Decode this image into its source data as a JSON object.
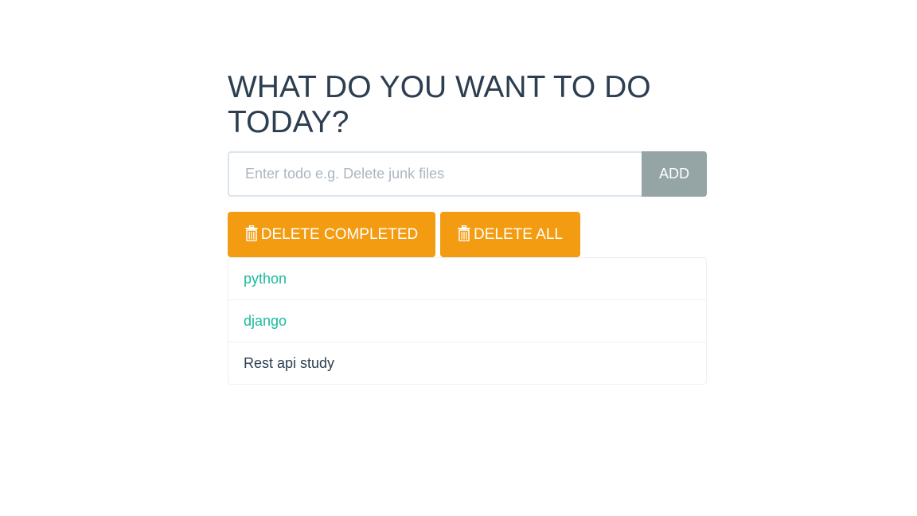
{
  "header": {
    "title": "WHAT DO YOU WANT TO DO TODAY?"
  },
  "form": {
    "input_value": "",
    "input_placeholder": "Enter todo e.g. Delete junk files",
    "add_label": "ADD"
  },
  "actions": {
    "delete_completed_label": "DELETE COMPLETED",
    "delete_all_label": "DELETE ALL",
    "icon": "trash-icon"
  },
  "todos": [
    {
      "label": "python",
      "completed": true
    },
    {
      "label": "django",
      "completed": true
    },
    {
      "label": "Rest api study",
      "completed": false
    }
  ],
  "colors": {
    "text": "#2c3e50",
    "accent_warning": "#f39c12",
    "add_button": "#95a5a6",
    "completed_text": "#18bc9c",
    "input_border": "#dce4ec"
  }
}
